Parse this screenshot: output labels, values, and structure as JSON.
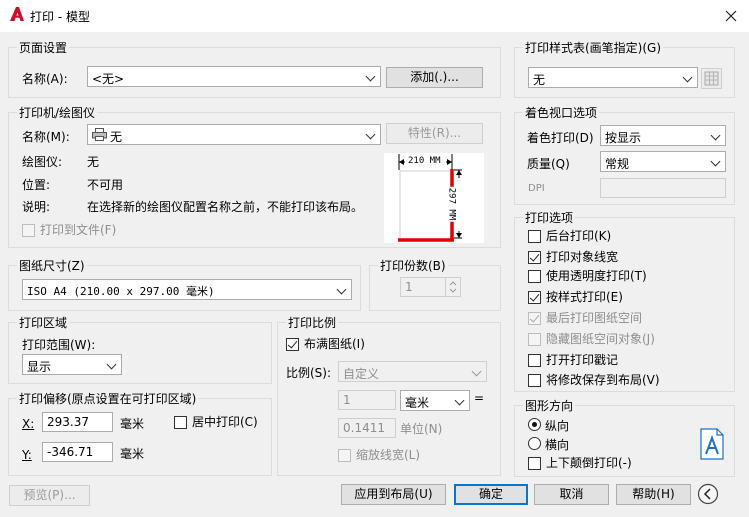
{
  "title": "打印 - 模型",
  "page_setup": {
    "group": "页面设置",
    "name_label": "名称(A):",
    "name_value": "<无>",
    "add_btn": "添加(.)..."
  },
  "printer": {
    "group": "打印机/绘图仪",
    "name_label": "名称(M):",
    "name_value": "无",
    "props_btn": "特性(R)...",
    "plotter_label": "绘图仪:",
    "plotter_value": "无",
    "location_label": "位置:",
    "location_value": "不可用",
    "desc_label": "说明:",
    "desc_value": "在选择新的绘图仪配置名称之前，不能打印该布局。",
    "print_to_file": "打印到文件(F)",
    "paper_width": "210 MM",
    "paper_height": "297 MM"
  },
  "paper_size": {
    "group": "图纸尺寸(Z)",
    "value": "ISO A4 (210.00 x 297.00 毫米)"
  },
  "copies": {
    "group": "打印份数(B)",
    "value": "1"
  },
  "plot_area": {
    "group": "打印区域",
    "range_label": "打印范围(W):",
    "range_value": "显示"
  },
  "plot_offset": {
    "group": "打印偏移(原点设置在可打印区域)",
    "x_label": "X:",
    "x_value": "293.37",
    "x_unit": "毫米",
    "y_label": "Y:",
    "y_value": "-346.71",
    "y_unit": "毫米",
    "center_label": "居中打印(C)"
  },
  "plot_scale": {
    "group": "打印比例",
    "fit_label": "布满图纸(I)",
    "scale_label": "比例(S):",
    "scale_value": "自定义",
    "value1": "1",
    "unit": "毫米",
    "value2": "0.1411",
    "unit2": "单位(N)",
    "scale_lineweights": "缩放线宽(L)"
  },
  "style_table": {
    "group": "打印样式表(画笔指定)(G)",
    "value": "无"
  },
  "shaded_viewport": {
    "group": "着色视口选项",
    "shade_label": "着色打印(D)",
    "shade_value": "按显示",
    "quality_label": "质量(Q)",
    "quality_value": "常规",
    "dpi_label": "DPI"
  },
  "plot_options": {
    "group": "打印选项",
    "items": [
      {
        "label": "后台打印(K)",
        "checked": false,
        "disabled": false
      },
      {
        "label": "打印对象线宽",
        "checked": true,
        "disabled": false
      },
      {
        "label": "使用透明度打印(T)",
        "checked": false,
        "disabled": false
      },
      {
        "label": "按样式打印(E)",
        "checked": true,
        "disabled": false
      },
      {
        "label": "最后打印图纸空间",
        "checked": true,
        "disabled": true
      },
      {
        "label": "隐藏图纸空间对象(J)",
        "checked": false,
        "disabled": true
      },
      {
        "label": "打开打印戳记",
        "checked": false,
        "disabled": false
      },
      {
        "label": "将修改保存到布局(V)",
        "checked": false,
        "disabled": false
      }
    ]
  },
  "orientation": {
    "group": "图形方向",
    "portrait": "纵向",
    "landscape": "横向",
    "upside_down": "上下颠倒打印(-)"
  },
  "buttons": {
    "preview": "预览(P)...",
    "apply": "应用到布局(U)",
    "ok": "确定",
    "cancel": "取消",
    "help": "帮助(H)"
  }
}
